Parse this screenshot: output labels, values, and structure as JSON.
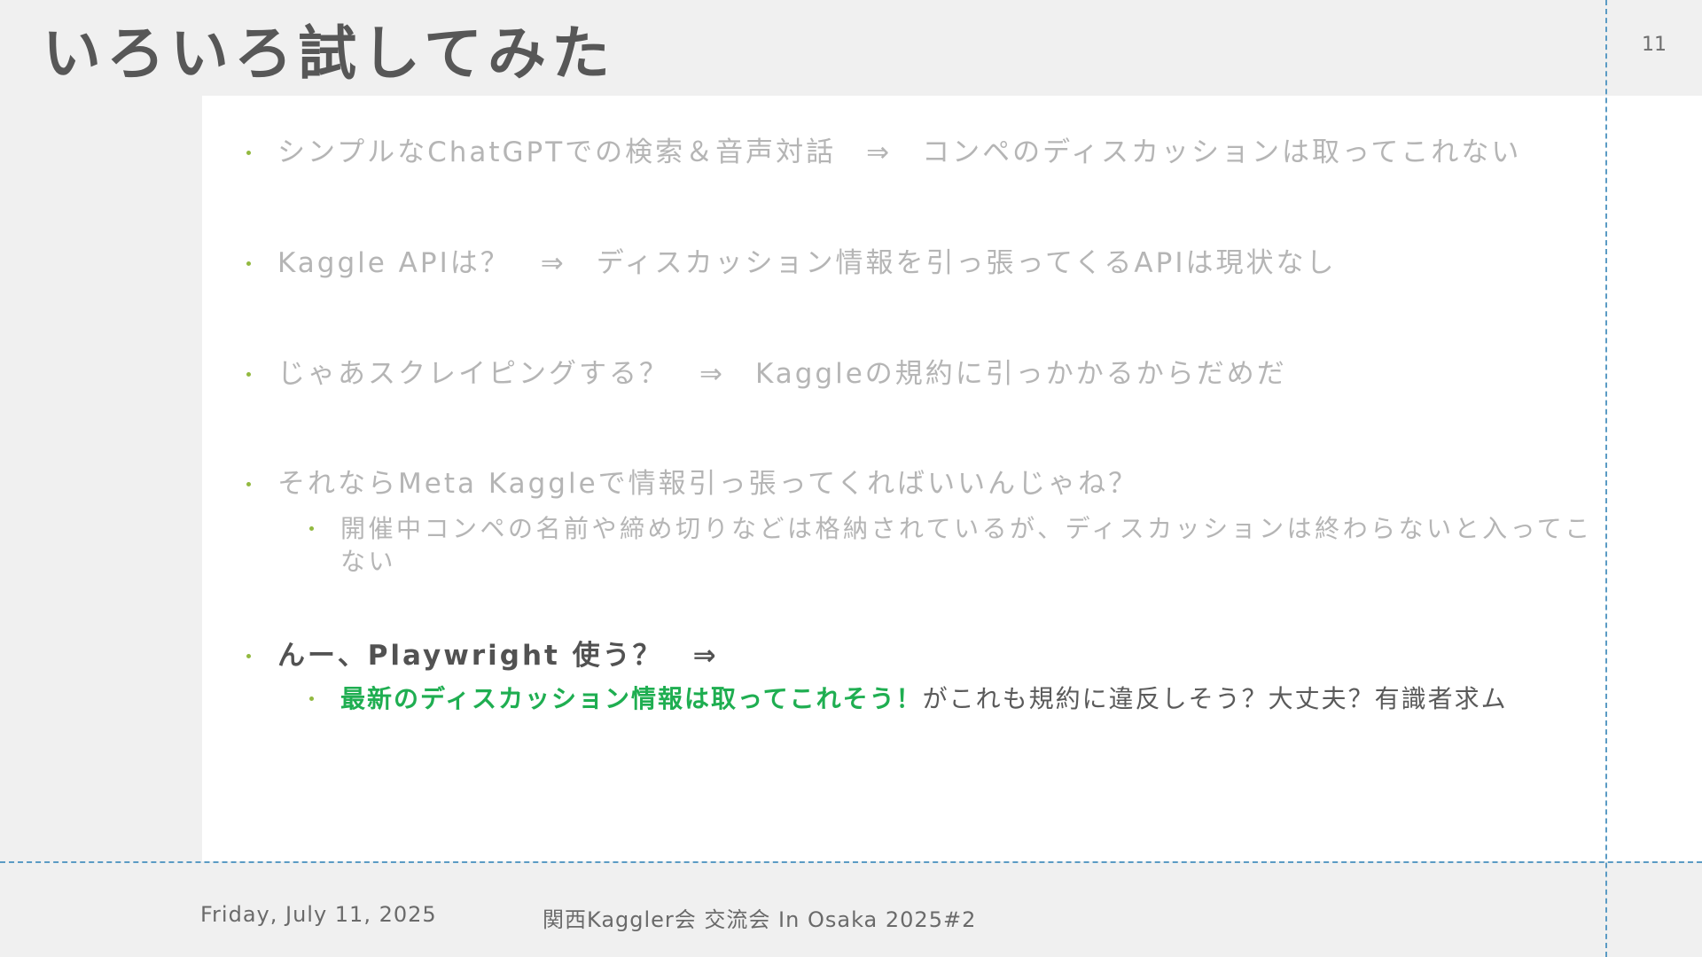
{
  "slide": {
    "title": "いろいろ試してみた",
    "page_number": "11"
  },
  "bullets": [
    {
      "text": "シンプルなChatGPTでの検索＆音声対話　⇒　コンペのディスカッションは取ってこれない"
    },
    {
      "text": "Kaggle APIは？　⇒　ディスカッション情報を引っ張ってくるAPIは現状なし"
    },
    {
      "text": "じゃあスクレイピングする？　⇒　Kaggleの規約に引っかかるからだめだ"
    },
    {
      "text": "それならMeta Kaggleで情報引っ張ってくればいいんじゃね？"
    },
    {
      "text": "んー、Playwright 使う？　⇒"
    }
  ],
  "sub_bullets": [
    {
      "text": "開催中コンペの名前や締め切りなどは格納されているが、ディスカッションは終わらないと入ってこない"
    },
    {
      "highlight": "最新のディスカッション情報は取ってこれそう！",
      "rest": "がこれも規約に違反しそう？大丈夫？有識者求ム"
    }
  ],
  "footer": {
    "date": "Friday, July 11, 2025",
    "event": "関西Kaggler会 交流会 In Osaka 2025#2"
  },
  "colors": {
    "bullet": "#92b940",
    "highlight": "#1fae51",
    "guide_line": "#5b9bc4",
    "faded_text": "#b5b5b5"
  }
}
